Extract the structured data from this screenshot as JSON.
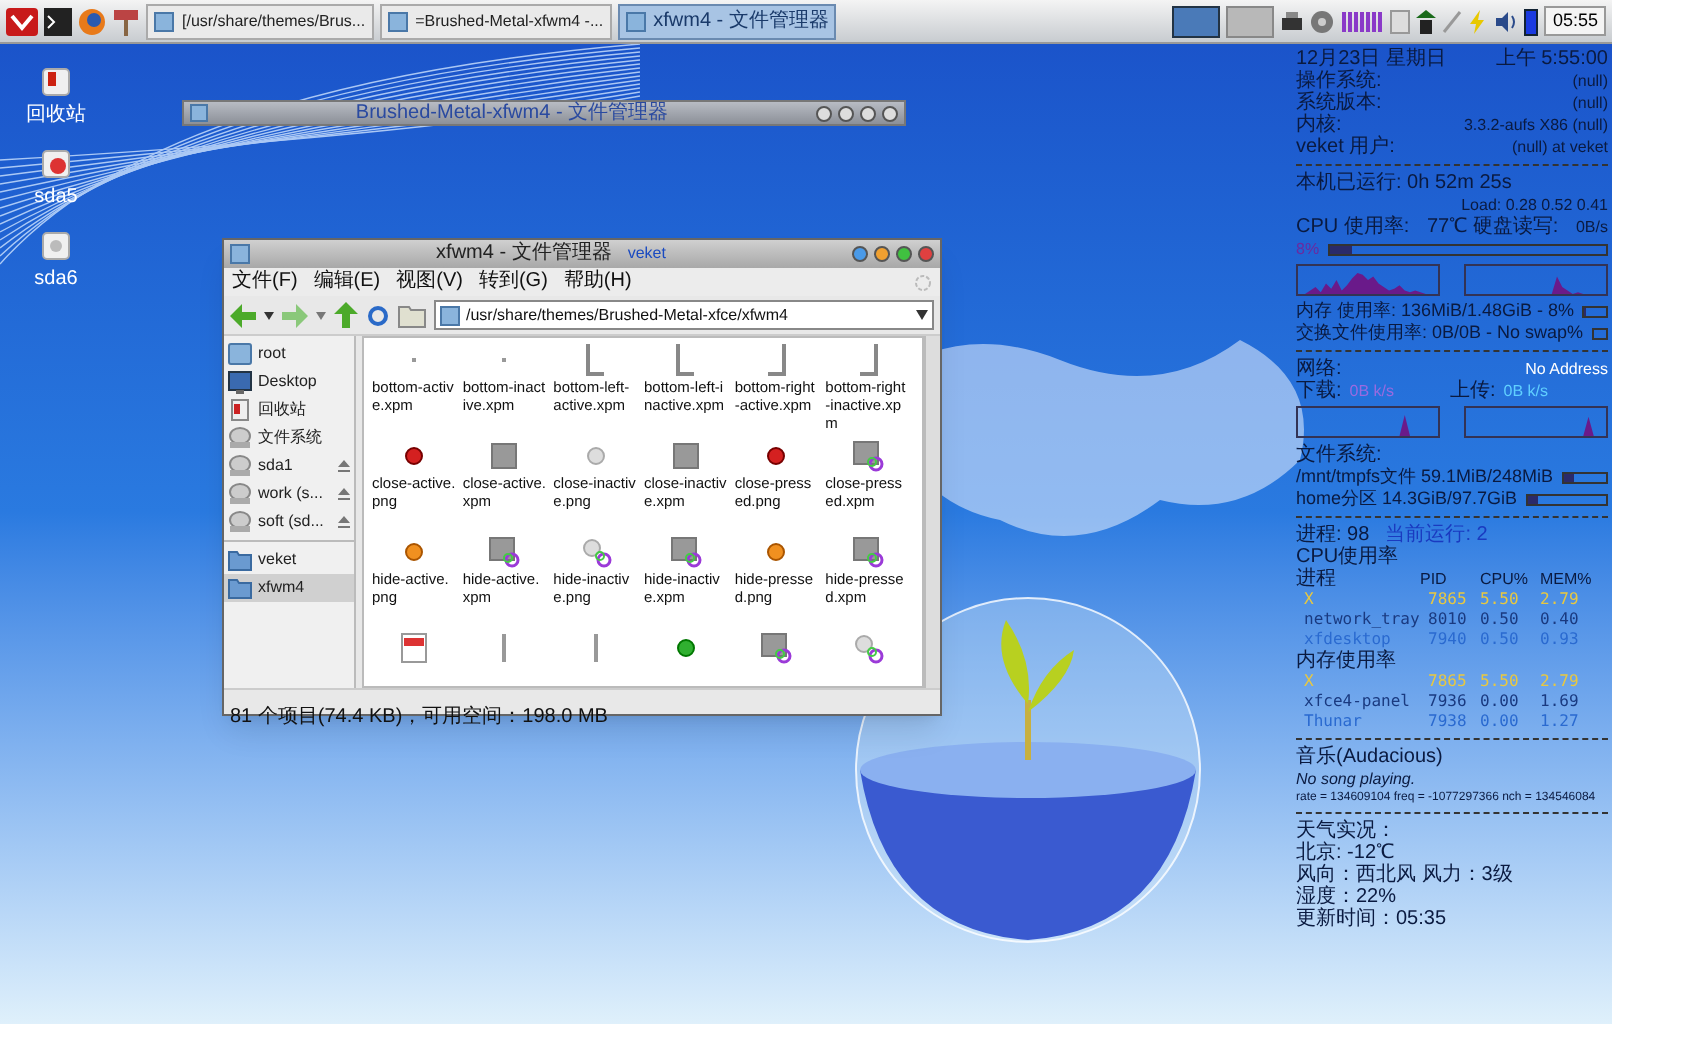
{
  "taskbar": {
    "tasks": [
      {
        "title": "[/usr/share/themes/Brus...",
        "selected": false
      },
      {
        "title": "=Brushed-Metal-xfwm4 -...",
        "selected": false
      },
      {
        "title": "xfwm4 - 文件管理器",
        "selected": true
      }
    ],
    "workspaces": [
      {
        "selected": true
      },
      {
        "selected": false
      }
    ],
    "clock": "05:55"
  },
  "desktop_icons": [
    {
      "label": "回收站",
      "kind": "trash"
    },
    {
      "label": "sda5",
      "kind": "mounted"
    },
    {
      "label": "sda6",
      "kind": "drive"
    }
  ],
  "shaded_window": {
    "title": "Brushed-Metal-xfwm4 - 文件管理器"
  },
  "file_manager": {
    "title": "xfwm4 - 文件管理器",
    "host": "veket",
    "menu": [
      "文件(F)",
      "编辑(E)",
      "视图(V)",
      "转到(G)",
      "帮助(H)"
    ],
    "path": "/usr/share/themes/Brushed-Metal-xfce/xfwm4",
    "devices": [
      {
        "label": "root",
        "kind": "home",
        "eject": false,
        "selected": false
      },
      {
        "label": "Desktop",
        "kind": "desktop",
        "eject": false,
        "selected": false
      },
      {
        "label": "回收站",
        "kind": "trash",
        "eject": false,
        "selected": false
      },
      {
        "label": "文件系统",
        "kind": "drive",
        "eject": false,
        "selected": false
      },
      {
        "label": "sda1",
        "kind": "drive",
        "eject": true,
        "selected": false
      },
      {
        "label": "work (s...",
        "kind": "drive",
        "eject": true,
        "selected": false
      },
      {
        "label": "soft (sd...",
        "kind": "drive",
        "eject": true,
        "selected": false
      }
    ],
    "bookmarks": [
      {
        "label": "veket",
        "selected": false
      },
      {
        "label": "xfwm4",
        "selected": true
      }
    ],
    "files": [
      {
        "name": "bottom-active.xpm",
        "kind": "dot"
      },
      {
        "name": "bottom-inactive.xpm",
        "kind": "dot"
      },
      {
        "name": "bottom-left-active.xpm",
        "kind": "left"
      },
      {
        "name": "bottom-left-inactive.xpm",
        "kind": "left"
      },
      {
        "name": "bottom-right-active.xpm",
        "kind": "right"
      },
      {
        "name": "bottom-right-inactive.xpm",
        "kind": "right"
      },
      {
        "name": "close-active.png",
        "kind": "red"
      },
      {
        "name": "close-active.xpm",
        "kind": "square"
      },
      {
        "name": "close-inactive.png",
        "kind": "grey"
      },
      {
        "name": "close-inactive.xpm",
        "kind": "square"
      },
      {
        "name": "close-pressed.png",
        "kind": "red"
      },
      {
        "name": "close-pressed.xpm",
        "kind": "link"
      },
      {
        "name": "hide-active.png",
        "kind": "orange"
      },
      {
        "name": "hide-active.xpm",
        "kind": "link"
      },
      {
        "name": "hide-inactive.png",
        "kind": "greylink"
      },
      {
        "name": "hide-inactive.xpm",
        "kind": "link"
      },
      {
        "name": "hide-pressed.png",
        "kind": "orange"
      },
      {
        "name": "hide-pressed.xpm",
        "kind": "link"
      },
      {
        "kind": "txt"
      },
      {
        "kind": "bar"
      },
      {
        "kind": "bar"
      },
      {
        "kind": "green"
      },
      {
        "kind": "link"
      },
      {
        "kind": "greylink"
      }
    ],
    "status": "81 个项目(74.4 KB)，可用空间：198.0 MB"
  },
  "conky": {
    "date": "12月23日 星期日",
    "time": "上午 5:55:00",
    "info": [
      {
        "label": "操作系统:",
        "value": "(null)"
      },
      {
        "label": "系统版本:",
        "value": "(null)"
      },
      {
        "label": "内核:",
        "value": "3.3.2-aufs X86 (null)"
      },
      {
        "label": "veket 用户:",
        "value": "(null) at veket"
      }
    ],
    "uptime": "本机已运行: 0h 52m 25s",
    "load": "Load: 0.28 0.52 0.41",
    "cpu_label": "CPU 使用率:",
    "temp": "77℃ 硬盘读写:",
    "disk_io": "0B/s",
    "cpu": {
      "reading": "8%",
      "level": 0.08
    },
    "memory": {
      "text": "内存 使用率: 136MiB/1.48GiB - 8%",
      "level": 0.08
    },
    "swap": {
      "text": "交换文件使用率: 0B/0B - No swap%",
      "level": 0
    },
    "network": {
      "label": "网络:",
      "address": "No Address",
      "down": "下载:",
      "down_value": "0B k/s",
      "up": "上传:",
      "up_value": "0B k/s"
    },
    "filesystem": {
      "title": "文件系统:",
      "items": [
        {
          "label": "/mnt/tmpfs文件 59.1MiB/248MiB",
          "level": 0.24
        },
        {
          "label": "home分区 14.3GiB/97.7GiB",
          "level": 0.15
        }
      ]
    },
    "processes": "进程: 98",
    "running": "当前运行: 2",
    "cpu_title": "CPU使用率",
    "columns": [
      "进程",
      "PID",
      "CPU%",
      "MEM%"
    ],
    "cpu_rows": [
      {
        "name": "X",
        "pid": "7865",
        "cpu": "5.50",
        "mem": "2.79",
        "color": "#e8c840"
      },
      {
        "name": "network_tray",
        "pid": "8010",
        "cpu": "0.50",
        "mem": "0.40",
        "color": "#1a3a80"
      },
      {
        "name": "xfdesktop",
        "pid": "7940",
        "cpu": "0.50",
        "mem": "0.93",
        "color": "#2a6ad0"
      }
    ],
    "mem_title": "内存使用率",
    "mem_rows": [
      {
        "name": "X",
        "pid": "7865",
        "cpu": "5.50",
        "mem": "2.79",
        "color": "#e8c840"
      },
      {
        "name": "xfce4-panel",
        "pid": "7936",
        "cpu": "0.00",
        "mem": "1.69",
        "color": "#1a3a80"
      },
      {
        "name": "Thunar",
        "pid": "7938",
        "cpu": "0.00",
        "mem": "1.27",
        "color": "#2a6ad0"
      }
    ],
    "music": {
      "title": "音乐(Audacious)",
      "status": "No song playing.",
      "rate": "rate = 134609104 freq = -1077297366 nch = 134546084"
    },
    "weather": {
      "title": "天气实况：",
      "lines": [
        "北京:   -12℃",
        "风向：西北风  风力：3级",
        "湿度：22%",
        "更新时间：05:35"
      ]
    }
  }
}
